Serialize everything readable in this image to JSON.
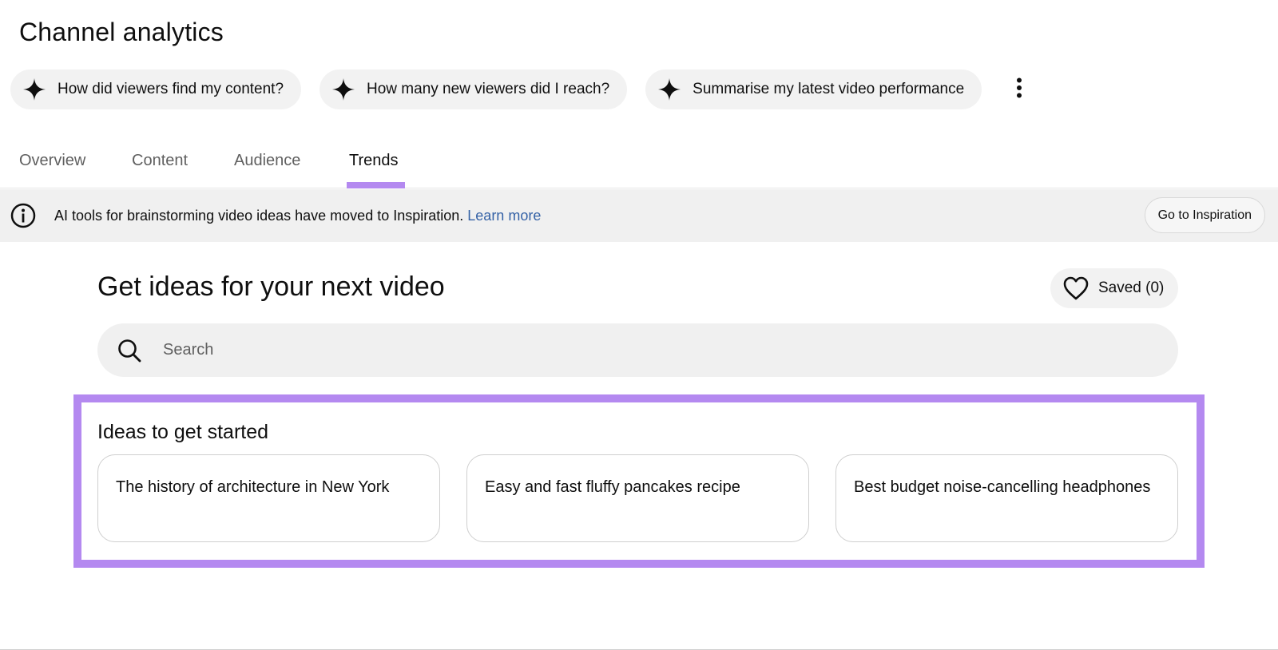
{
  "header": {
    "title": "Channel analytics"
  },
  "suggestions": [
    {
      "label": "How did viewers find my content?",
      "icon": "sparkle-icon"
    },
    {
      "label": "How many new viewers did I reach?",
      "icon": "sparkle-icon"
    },
    {
      "label": "Summarise my latest video performance",
      "icon": "sparkle-icon"
    }
  ],
  "more_menu": {
    "icon": "more-vertical-icon"
  },
  "tabs": [
    {
      "label": "Overview",
      "active": false
    },
    {
      "label": "Content",
      "active": false
    },
    {
      "label": "Audience",
      "active": false
    },
    {
      "label": "Trends",
      "active": true
    }
  ],
  "banner": {
    "icon": "info-icon",
    "message": "AI tools for brainstorming video ideas have moved to Inspiration.",
    "link": "Learn more",
    "button": "Go to Inspiration"
  },
  "ideas_section": {
    "title": "Get ideas for your next video",
    "saved_label": "Saved (0)",
    "saved_icon": "heart-icon",
    "search": {
      "placeholder": "Search",
      "value": "",
      "icon": "search-icon"
    },
    "started_title": "Ideas to get started",
    "cards": [
      "The history of architecture in New York",
      "Easy and fast fluffy pancakes recipe",
      "Best budget noise-cancelling headphones"
    ]
  },
  "colors": {
    "accent": "#b489f0",
    "link": "#3562a6",
    "chip_bg": "#f2f2f2",
    "banner_bg": "#f0f0f0"
  }
}
